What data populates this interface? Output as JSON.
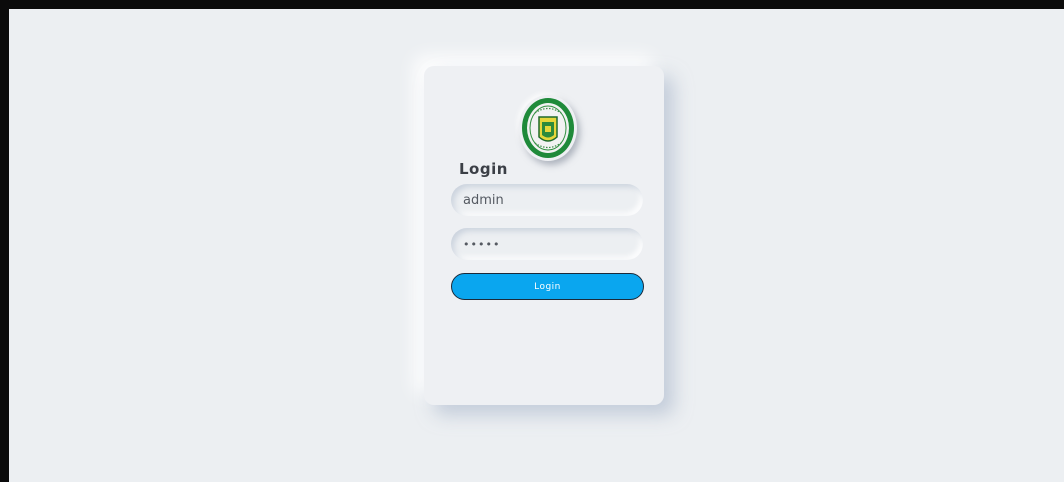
{
  "login": {
    "logo": {
      "icon": "university-seal-icon",
      "colors": {
        "outer_ring": "#1f8a3a",
        "inner_ring": "#f2f2f2",
        "emblem_fill": "#e6d63a",
        "emblem_border": "#1f6b2d"
      }
    },
    "title": "Login",
    "username": {
      "value": "admin",
      "placeholder": ""
    },
    "password": {
      "value": "admin",
      "placeholder": ""
    },
    "submit_label": "Login"
  },
  "theme": {
    "background": "#eceff2",
    "card": "#eef0f3",
    "accent": "#0aa6ef"
  }
}
